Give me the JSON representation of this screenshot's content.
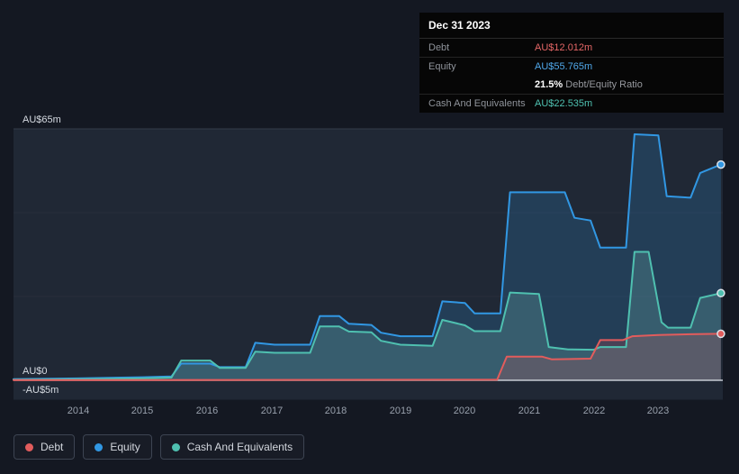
{
  "tooltip": {
    "date": "Dec 31 2023",
    "rows": [
      {
        "label": "Debt",
        "value": "AU$12.012m",
        "color": "#e56767"
      },
      {
        "label": "Equity",
        "value": "AU$55.765m",
        "color": "#50a8ea"
      },
      {
        "label": "Cash And Equivalents",
        "value": "AU$22.535m",
        "color": "#4fc0b0"
      }
    ],
    "ratio": {
      "percent": "21.5%",
      "text": "Debt/Equity Ratio"
    }
  },
  "legend": {
    "items": [
      {
        "label": "Debt",
        "color": "#e25c5c"
      },
      {
        "label": "Equity",
        "color": "#3197e3"
      },
      {
        "label": "Cash And Equivalents",
        "color": "#4fc0b0"
      }
    ]
  },
  "chart_data": {
    "type": "area",
    "x_range": [
      2013.0,
      2024.0
    ],
    "y_range": [
      -5,
      65
    ],
    "y_gridlines": [
      65,
      43.33,
      21.67,
      0
    ],
    "y_ticks": [
      {
        "label": "AU$65m",
        "value": 65
      },
      {
        "label": "AU$0",
        "value": 0
      },
      {
        "label": "-AU$5m",
        "value": -5
      }
    ],
    "x_ticks": [
      "2014",
      "2015",
      "2016",
      "2017",
      "2018",
      "2019",
      "2020",
      "2021",
      "2022",
      "2023"
    ],
    "colors": {
      "plot_bg": "#202835",
      "grid": "#272e3b",
      "grid_strong": "#343b49",
      "zero_line": "#c6cbd3"
    },
    "series": [
      {
        "id": "equity",
        "name": "Equity",
        "color": "#3197e3",
        "fill": "rgba(49,151,227,0.20)",
        "points": [
          [
            2013.0,
            0.3
          ],
          [
            2014.0,
            0.5
          ],
          [
            2015.0,
            0.8
          ],
          [
            2015.45,
            1.0
          ],
          [
            2015.6,
            4.3
          ],
          [
            2016.05,
            4.3
          ],
          [
            2016.2,
            3.4
          ],
          [
            2016.6,
            3.4
          ],
          [
            2016.75,
            9.7
          ],
          [
            2017.05,
            9.2
          ],
          [
            2017.6,
            9.2
          ],
          [
            2017.75,
            16.6
          ],
          [
            2018.05,
            16.6
          ],
          [
            2018.2,
            14.6
          ],
          [
            2018.55,
            14.3
          ],
          [
            2018.7,
            12.3
          ],
          [
            2019.0,
            11.4
          ],
          [
            2019.5,
            11.4
          ],
          [
            2019.65,
            20.4
          ],
          [
            2020.0,
            20.0
          ],
          [
            2020.15,
            17.3
          ],
          [
            2020.55,
            17.3
          ],
          [
            2020.7,
            48.6
          ],
          [
            2021.55,
            48.6
          ],
          [
            2021.7,
            42.0
          ],
          [
            2021.95,
            41.3
          ],
          [
            2022.1,
            34.3
          ],
          [
            2022.5,
            34.3
          ],
          [
            2022.63,
            63.6
          ],
          [
            2023.0,
            63.3
          ],
          [
            2023.13,
            47.6
          ],
          [
            2023.5,
            47.2
          ],
          [
            2023.65,
            53.6
          ],
          [
            2023.97,
            55.765
          ]
        ]
      },
      {
        "id": "cash",
        "name": "Cash And Equivalents",
        "color": "#4fc0b0",
        "fill": "rgba(127,205,197,0.22)",
        "points": [
          [
            2013.0,
            0.15
          ],
          [
            2014.0,
            0.3
          ],
          [
            2015.0,
            0.5
          ],
          [
            2015.45,
            0.7
          ],
          [
            2015.6,
            5.1
          ],
          [
            2016.05,
            5.1
          ],
          [
            2016.2,
            3.2
          ],
          [
            2016.6,
            3.2
          ],
          [
            2016.75,
            7.4
          ],
          [
            2017.05,
            7.1
          ],
          [
            2017.6,
            7.1
          ],
          [
            2017.75,
            13.9
          ],
          [
            2018.05,
            13.9
          ],
          [
            2018.2,
            12.6
          ],
          [
            2018.55,
            12.4
          ],
          [
            2018.7,
            10.2
          ],
          [
            2019.0,
            9.2
          ],
          [
            2019.5,
            8.9
          ],
          [
            2019.65,
            15.6
          ],
          [
            2020.0,
            14.2
          ],
          [
            2020.15,
            12.7
          ],
          [
            2020.55,
            12.7
          ],
          [
            2020.7,
            22.7
          ],
          [
            2021.15,
            22.3
          ],
          [
            2021.3,
            8.6
          ],
          [
            2021.6,
            8.0
          ],
          [
            2022.0,
            7.9
          ],
          [
            2022.1,
            8.6
          ],
          [
            2022.5,
            8.6
          ],
          [
            2022.63,
            33.2
          ],
          [
            2022.85,
            33.2
          ],
          [
            2023.05,
            15.0
          ],
          [
            2023.15,
            13.6
          ],
          [
            2023.5,
            13.6
          ],
          [
            2023.65,
            21.3
          ],
          [
            2023.97,
            22.535
          ]
        ]
      },
      {
        "id": "debt",
        "name": "Debt",
        "color": "#e25c5c",
        "fill": "rgba(226,87,87,0.20)",
        "points": [
          [
            2013.0,
            0.05
          ],
          [
            2016.0,
            0.1
          ],
          [
            2020.5,
            0.15
          ],
          [
            2020.65,
            6.1
          ],
          [
            2021.2,
            6.1
          ],
          [
            2021.35,
            5.4
          ],
          [
            2021.95,
            5.6
          ],
          [
            2022.1,
            10.4
          ],
          [
            2022.45,
            10.4
          ],
          [
            2022.6,
            11.4
          ],
          [
            2023.0,
            11.7
          ],
          [
            2023.5,
            11.9
          ],
          [
            2023.97,
            12.012
          ]
        ]
      }
    ]
  }
}
